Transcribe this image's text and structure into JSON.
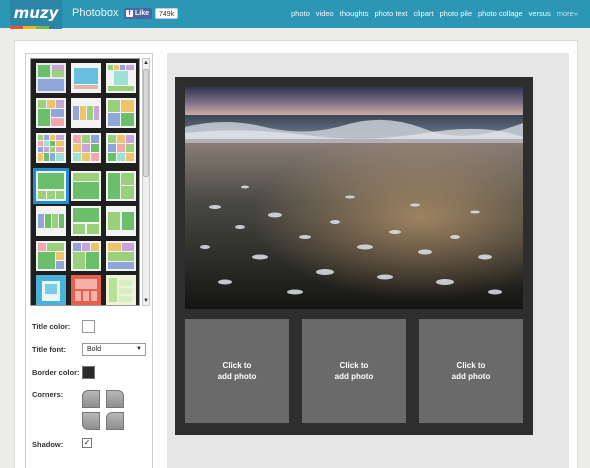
{
  "header": {
    "logo": "muzy",
    "app_title": "Photobox",
    "like_label": "Like",
    "like_count": "749k",
    "nav": [
      "photo",
      "video",
      "thoughts",
      "photo text",
      "clipart",
      "photo pile",
      "photo collage",
      "versus",
      "more»"
    ]
  },
  "sidebar": {
    "options": {
      "title_color_label": "Title color:",
      "title_font_label": "Title font:",
      "title_font_value": "Bold",
      "border_color_label": "Border color:",
      "corners_label": "Corners:",
      "shadow_label": "Shadow:",
      "shadow_checked": "✓"
    }
  },
  "collage": {
    "slots": [
      "Click to\nadd photo",
      "Click to\nadd photo",
      "Click to\nadd photo"
    ]
  },
  "colors": {
    "header_bg": "#2b97b5",
    "selected_thumb": "#1f8ed1",
    "collage_bg": "#2e2e2e",
    "slot_bg": "#6a6a6a"
  }
}
